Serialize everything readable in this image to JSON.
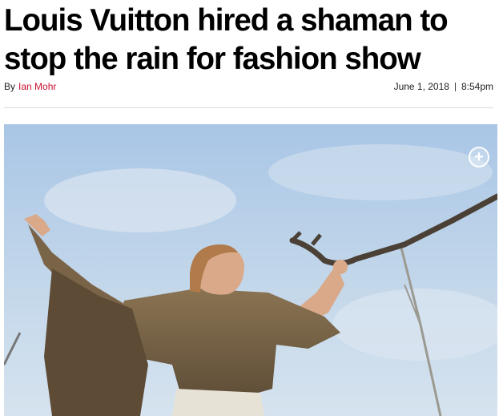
{
  "article": {
    "headline": "Louis Vuitton hired a shaman to stop the rain for fashion show",
    "byline_prefix": "By",
    "author": "Ian Mohr",
    "date": "June 1, 2018",
    "time": "8:54pm"
  },
  "photo": {
    "expand_icon": "plus-circle-icon"
  },
  "colors": {
    "author_link": "#c8102e",
    "sky": "#b9d1e8",
    "divider": "#d9d9d9"
  }
}
